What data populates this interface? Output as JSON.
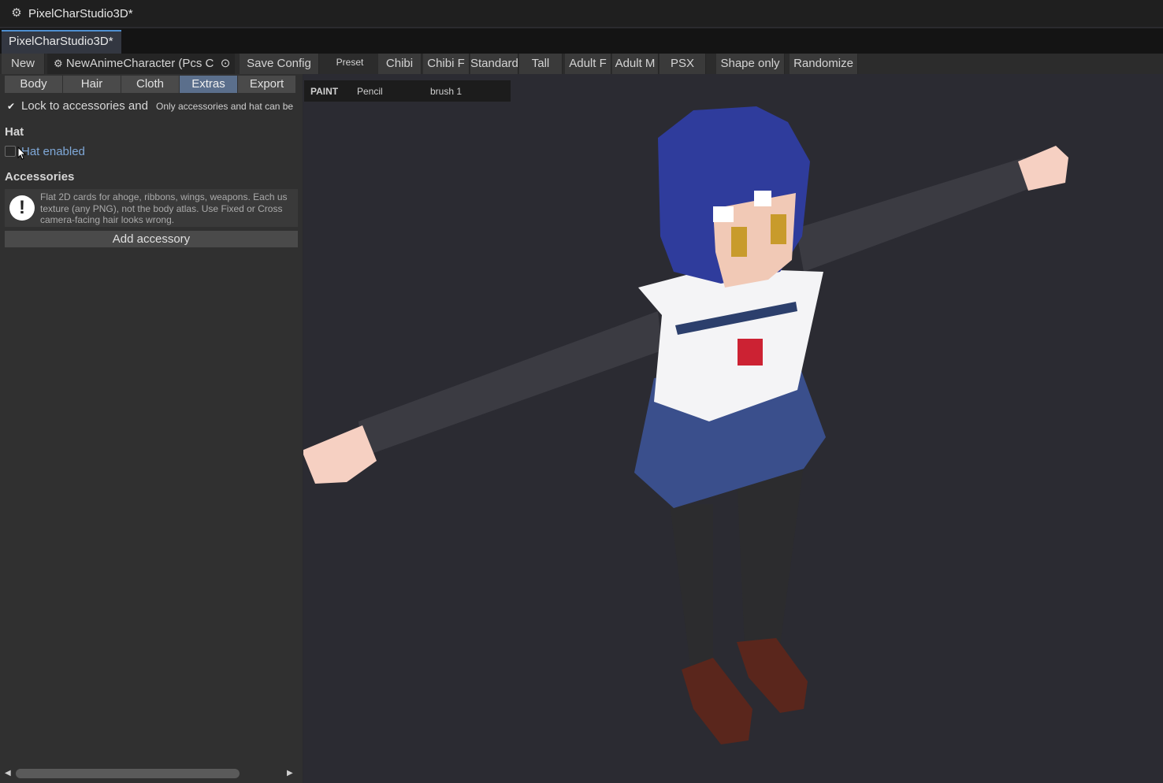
{
  "window": {
    "title": "PixelCharStudio3D*",
    "icon": "gear-icon"
  },
  "doc_tab": {
    "label": "PixelCharStudio3D*"
  },
  "toolbar": {
    "new_label": "New",
    "character_field": "NewAnimeCharacter (Pcs C",
    "character_icon": "resource-icon",
    "pick_icon": "target-icon",
    "save_config_label": "Save Config",
    "preset_label": "Preset",
    "presets": [
      "Chibi",
      "Chibi F",
      "Standard",
      "Tall",
      "Adult F",
      "Adult M",
      "PSX"
    ],
    "shape_only_label": "Shape only",
    "randomize_label": "Randomize"
  },
  "panel": {
    "tabs": [
      "Body",
      "Hair",
      "Cloth",
      "Extras",
      "Export"
    ],
    "active_tab": "Extras",
    "lock_label": "Lock to accessories and",
    "lock_hint": "Only accessories and hat can be",
    "lock_checked": true,
    "hat_section": "Hat",
    "hat_enabled_label": "Hat enabled",
    "hat_enabled_checked": false,
    "accessories_section": "Accessories",
    "info_lines": [
      "Flat 2D cards for ahoge, ribbons, wings, weapons. Each us",
      "texture (any PNG), not the body atlas. Use Fixed or Cross",
      "camera-facing hair looks wrong."
    ],
    "add_accessory_label": "Add accessory"
  },
  "paint_bar": {
    "mode": "PAINT",
    "tool": "Pencil",
    "brush": "brush 1"
  },
  "colors": {
    "accent": "#4e8fd1",
    "active_tab": "#5b6f8c",
    "link_text": "#7fa8d8",
    "viewport_bg": "#2b2b32"
  }
}
